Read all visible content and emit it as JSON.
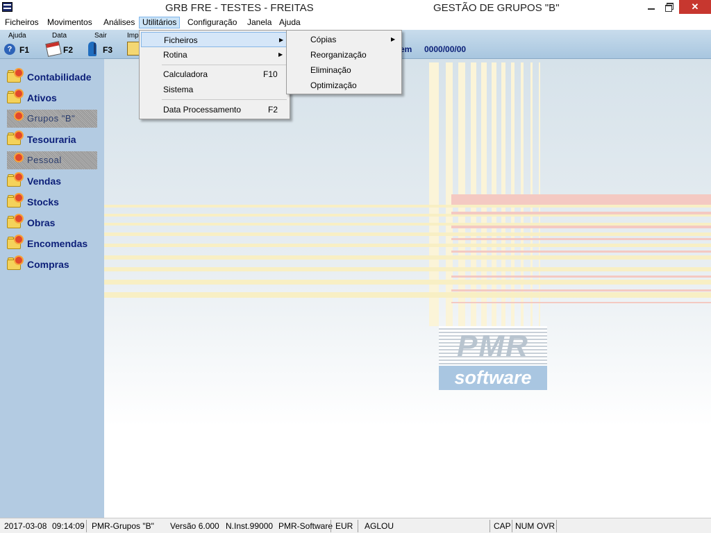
{
  "window": {
    "title": "GRB FRE - TESTES - FREITAS",
    "subtitle": "GESTÃO DE GRUPOS \"B\"",
    "close_glyph": "✕"
  },
  "menubar": {
    "items": [
      "Ficheiros",
      "Movimentos",
      "Análises",
      "Utilitários",
      "Configuração",
      "Janela",
      "Ajuda"
    ]
  },
  "toolbar": {
    "tools": [
      {
        "label": "Ajuda",
        "key": "F1",
        "icon": "help-icon"
      },
      {
        "label": "Data",
        "key": "F2",
        "icon": "calendar-icon"
      },
      {
        "label": "Sair",
        "key": "F3",
        "icon": "exit-icon"
      },
      {
        "label": "Imp",
        "key": "",
        "icon": "print-icon"
      }
    ],
    "date_prefix": "a em",
    "date_value": "0000/00/00"
  },
  "sidebar": {
    "items": [
      {
        "label": "Contabilidade",
        "enabled": true
      },
      {
        "label": "Ativos",
        "enabled": true
      },
      {
        "label": "Grupos \"B\"",
        "enabled": false
      },
      {
        "label": "Tesouraria",
        "enabled": true
      },
      {
        "label": "Pessoal",
        "enabled": false
      },
      {
        "label": "Vendas",
        "enabled": true
      },
      {
        "label": "Stocks",
        "enabled": true
      },
      {
        "label": "Obras",
        "enabled": true
      },
      {
        "label": "Encomendas",
        "enabled": true
      },
      {
        "label": "Compras",
        "enabled": true
      }
    ]
  },
  "utilitarios_menu": {
    "items": [
      {
        "label": "Ficheiros",
        "shortcut": "",
        "submenu": true
      },
      {
        "label": "Rotina",
        "shortcut": "",
        "submenu": true
      },
      {
        "label": "Calculadora",
        "shortcut": "F10",
        "submenu": false
      },
      {
        "label": "Sistema",
        "shortcut": "",
        "submenu": false
      },
      {
        "label": "Data Processamento",
        "shortcut": "F2",
        "submenu": false
      }
    ]
  },
  "ficheiros_submenu": {
    "items": [
      {
        "label": "Cópias",
        "submenu": true
      },
      {
        "label": "Reorganização",
        "submenu": false
      },
      {
        "label": "Eliminação",
        "submenu": false
      },
      {
        "label": "Optimização",
        "submenu": false
      }
    ]
  },
  "logo": {
    "top": "PMR",
    "bottom": "software"
  },
  "statusbar": {
    "date": "2017-03-08",
    "time": "09:14:09",
    "module": "PMR-Grupos \"B\"",
    "version": "Versão  6.000",
    "inst": "N.Inst.99000",
    "vendor": "PMR-Software",
    "currency": "EUR",
    "user": "AGLOU",
    "cap": "CAP",
    "num": "NUM",
    "ovr": "OVR"
  },
  "colors": {
    "sidebar_bg": "#b3cbe2",
    "sidebar_text": "#0b1e78",
    "menu_highlight": "#d5e6f8",
    "close_button": "#c7372f"
  }
}
